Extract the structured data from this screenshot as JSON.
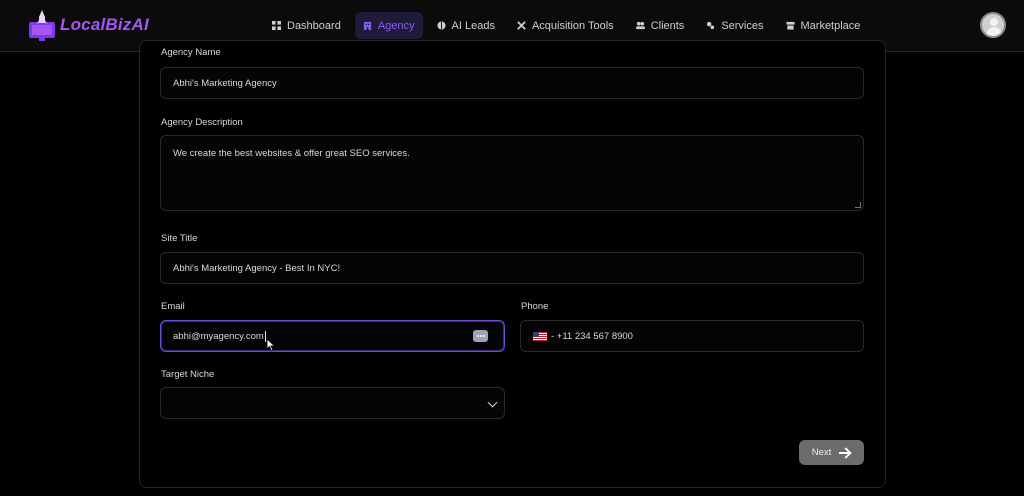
{
  "app": {
    "logo_text": "LocalBizAI"
  },
  "nav": {
    "items": [
      {
        "label": "Dashboard",
        "icon": "grid-icon",
        "active": false
      },
      {
        "label": "Agency",
        "icon": "building-icon",
        "active": true
      },
      {
        "label": "AI Leads",
        "icon": "brain-icon",
        "active": false
      },
      {
        "label": "Acquisition Tools",
        "icon": "tools-icon",
        "active": false
      },
      {
        "label": "Clients",
        "icon": "users-icon",
        "active": false
      },
      {
        "label": "Services",
        "icon": "gears-icon",
        "active": false
      },
      {
        "label": "Marketplace",
        "icon": "store-icon",
        "active": false
      }
    ],
    "active_color": "#8b5cf6"
  },
  "form": {
    "agency_name": {
      "label": "Agency Name",
      "value": "Abhi's Marketing Agency"
    },
    "agency_description": {
      "label": "Agency Description",
      "value": "We create the best websites & offer great SEO services."
    },
    "site_title": {
      "label": "Site Title",
      "value": "Abhi's Marketing Agency - Best In NYC!"
    },
    "email": {
      "label": "Email",
      "value": "abhi@myagency.com"
    },
    "phone": {
      "label": "Phone",
      "value": "- +11 234 567 8900",
      "flag_icon": "us-flag-icon"
    },
    "target_niche": {
      "label": "Target Niche",
      "value": ""
    },
    "next_label": "Next"
  }
}
